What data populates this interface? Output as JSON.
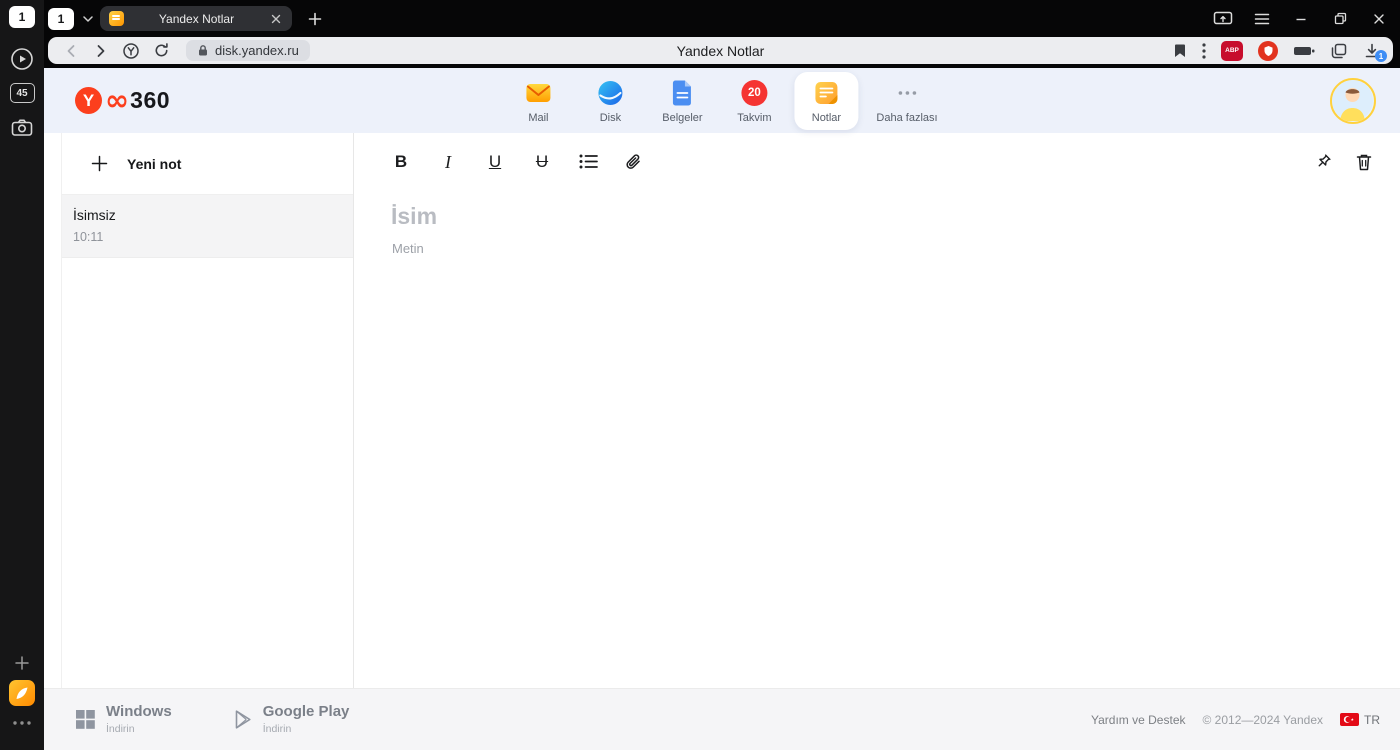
{
  "browser": {
    "sidebar": {
      "tabs_count": "1",
      "badge": "45"
    },
    "tabstrip": {
      "tab_counter": "1",
      "tab_title": "Yandex Notlar"
    },
    "omnibox": {
      "url": "disk.yandex.ru",
      "page_title": "Yandex Notlar",
      "abp_label": "ABP",
      "download_badge": "1"
    }
  },
  "header": {
    "logo_y": "Y",
    "logo_suffix": "360",
    "services": [
      {
        "label": "Mail"
      },
      {
        "label": "Disk"
      },
      {
        "label": "Belgeler"
      },
      {
        "label": "Takvim",
        "badge": "20"
      },
      {
        "label": "Notlar"
      },
      {
        "label": "Daha fazlası"
      }
    ]
  },
  "notes": {
    "new_note_label": "Yeni not",
    "items": [
      {
        "title": "İsimsiz",
        "time": "10:11"
      }
    ]
  },
  "editor": {
    "bold_label": "B",
    "italic_label": "I",
    "underline_label": "U",
    "strike_label": "U",
    "title_placeholder": "İsim",
    "body_placeholder": "Metin"
  },
  "footer": {
    "windows_title": "Windows",
    "windows_sub": "İndirin",
    "gplay_title": "Google Play",
    "gplay_sub": "İndirin",
    "help": "Yardım ve Destek",
    "copyright": "© 2012—2024 Yandex",
    "lang": "TR"
  }
}
